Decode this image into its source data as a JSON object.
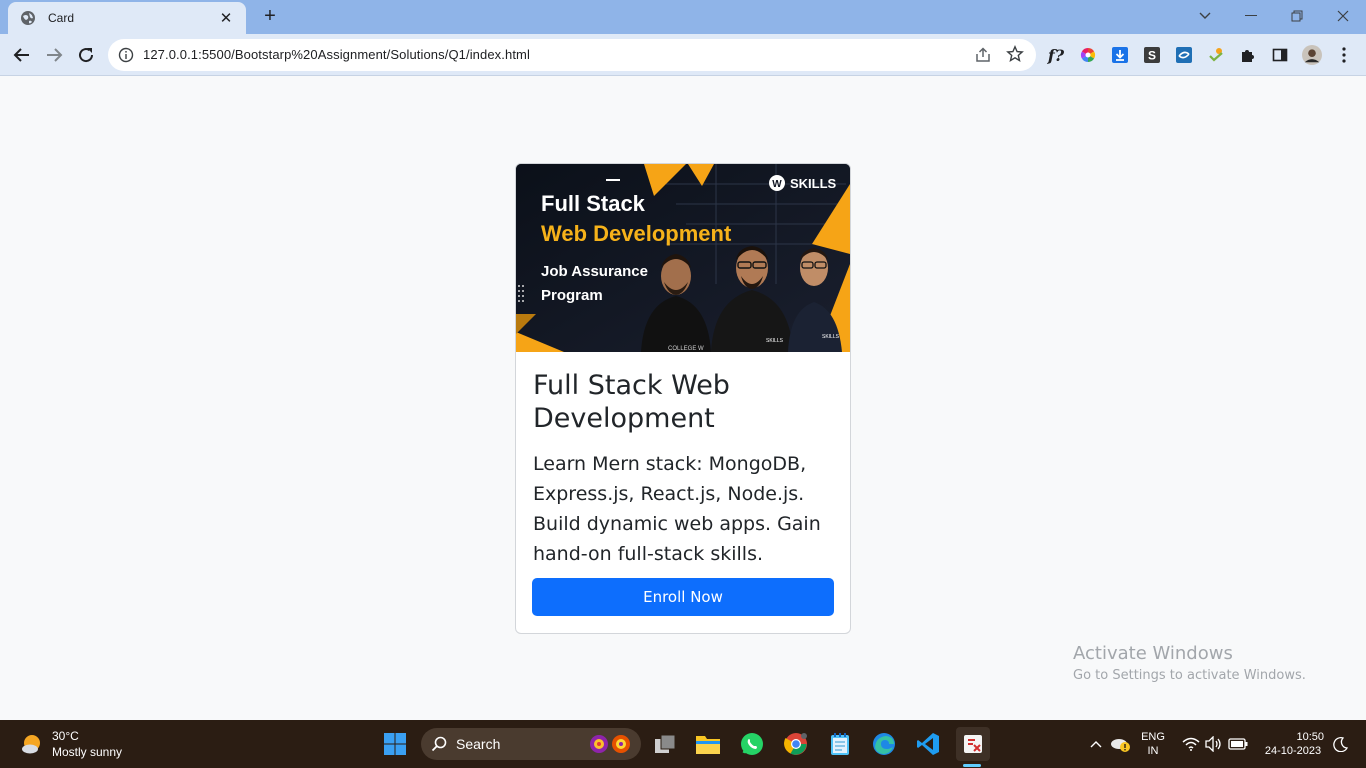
{
  "browser": {
    "tab_title": "Card",
    "new_tab": "+",
    "url": "127.0.0.1:5500/Bootstarp%20Assignment/Solutions/Q1/index.html"
  },
  "card": {
    "banner": {
      "brand": "SKILLS",
      "headline_1": "Full Stack",
      "headline_2": "Web Development",
      "sub_1": "Job Assurance",
      "sub_2": "Program",
      "shirt_text": "COLLEGE W",
      "shirt_logo": "SKILLS"
    },
    "title": "Full Stack Web Development",
    "text": "Learn Mern stack: MongoDB, Express.js, React.js, Node.js. Build dynamic web apps. Gain hand-on full-stack skills.",
    "button": "Enroll Now"
  },
  "watermark": {
    "title": "Activate Windows",
    "subtitle": "Go to Settings to activate Windows."
  },
  "taskbar": {
    "temp": "30°C",
    "condition": "Mostly sunny",
    "search": "Search",
    "lang_1": "ENG",
    "lang_2": "IN",
    "time": "10:50",
    "date": "24-10-2023"
  },
  "colors": {
    "accent": "#0d6efd",
    "banner_orange": "#f6a416",
    "tabbar": "#8fb4e8"
  }
}
